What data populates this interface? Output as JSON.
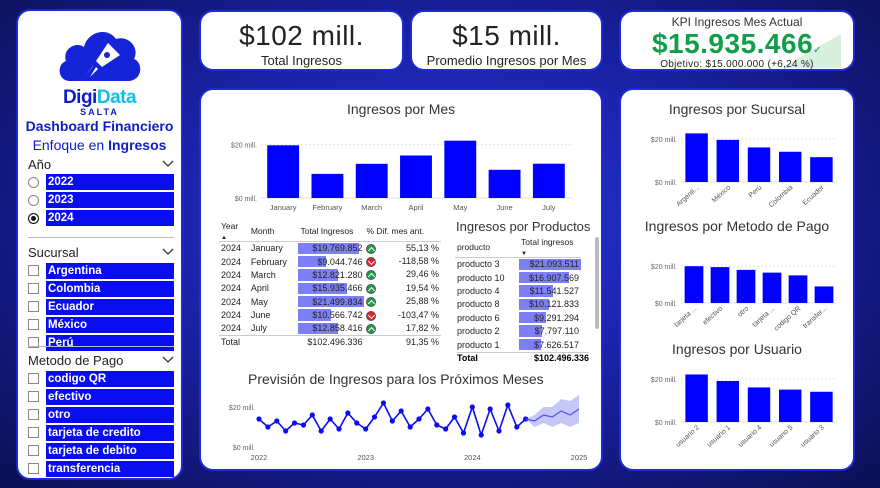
{
  "sidebar": {
    "logo": {
      "brand_a": "Digi",
      "brand_b": "Data",
      "sub": "SALTA"
    },
    "title_line1": "Dashboard Financiero",
    "title_line2_a": "Enfoque en ",
    "title_line2_b": "Ingresos",
    "year_filter": {
      "label": "Año",
      "options": [
        "2022",
        "2023",
        "2024"
      ],
      "selected": "2024"
    },
    "branch_filter": {
      "label": "Sucursal",
      "options": [
        "Argentina",
        "Colombia",
        "Ecuador",
        "México",
        "Perú"
      ]
    },
    "payment_filter": {
      "label": "Metodo de Pago",
      "options": [
        "codigo QR",
        "efectivo",
        "otro",
        "tarjeta de credito",
        "tarjeta de debito",
        "transferencia"
      ]
    }
  },
  "kpis": {
    "total": {
      "value": "$102 mill.",
      "label": "Total Ingresos"
    },
    "avg": {
      "value": "$15 mill.",
      "label": "Promedio Ingresos por Mes"
    },
    "current": {
      "title": "KPI Ingresos Mes Actual",
      "value": "$15.935.466",
      "goal": "Objetivo: $15.000.000 (+6,24 %)"
    }
  },
  "month_panel": {
    "title": "Ingresos por Mes",
    "table_headers": {
      "year": "Year",
      "month": "Month",
      "total": "Total Ingresos",
      "diff": "% Dif. mes ant."
    },
    "rows": [
      {
        "year": "2024",
        "month": "January",
        "total": "$19.769.852",
        "value": 19.77,
        "dir": "up",
        "diff": "55,13 %"
      },
      {
        "year": "2024",
        "month": "February",
        "total": "$9.044.746",
        "value": 9.04,
        "dir": "down",
        "diff": "-118,58 %"
      },
      {
        "year": "2024",
        "month": "March",
        "total": "$12.821.280",
        "value": 12.82,
        "dir": "up",
        "diff": "29,46 %"
      },
      {
        "year": "2024",
        "month": "April",
        "total": "$15.935.466",
        "value": 15.94,
        "dir": "up",
        "diff": "19,54 %"
      },
      {
        "year": "2024",
        "month": "May",
        "total": "$21.499.834",
        "value": 21.5,
        "dir": "up",
        "diff": "25,88 %"
      },
      {
        "year": "2024",
        "month": "June",
        "total": "$10.566.742",
        "value": 10.57,
        "dir": "down",
        "diff": "-103,47 %"
      },
      {
        "year": "2024",
        "month": "July",
        "total": "$12.858.416",
        "value": 12.86,
        "dir": "up",
        "diff": "17,82 %"
      }
    ],
    "total_row": {
      "label": "Total",
      "total": "$102.496.336",
      "diff": "91,35 %"
    }
  },
  "products_panel": {
    "title": "Ingresos por Productos",
    "headers": {
      "product": "producto",
      "total": "Total ingresos"
    },
    "rows": [
      {
        "name": "producto 3",
        "total": "$21.093.511",
        "value": 21.09
      },
      {
        "name": "producto 10",
        "total": "$16.907.569",
        "value": 16.91
      },
      {
        "name": "producto 4",
        "total": "$11.541.527",
        "value": 11.54
      },
      {
        "name": "producto 8",
        "total": "$10.121.833",
        "value": 10.12
      },
      {
        "name": "producto 6",
        "total": "$9.291.294",
        "value": 9.29
      },
      {
        "name": "producto 2",
        "total": "$7.797.110",
        "value": 7.8
      },
      {
        "name": "producto 1",
        "total": "$7.626.517",
        "value": 7.63
      }
    ],
    "total_row": {
      "label": "Total",
      "total": "$102.496.336"
    }
  },
  "forecast_title": "Previsión de Ingresos para los Próximos Meses",
  "right_titles": {
    "branch": "Ingresos por Sucursal",
    "payment": "Ingresos por Metodo de Pago",
    "user": "Ingresos por Usuario"
  },
  "colors": {
    "bar": "#0000ff",
    "accent": "#1c2bd8",
    "kpi_green": "#119e4a",
    "databar": "#7d7ff5"
  },
  "chart_data": [
    {
      "type": "bar",
      "title": "Ingresos por Mes",
      "categories": [
        "January",
        "February",
        "March",
        "April",
        "May",
        "June",
        "July"
      ],
      "values": [
        19.77,
        9.04,
        12.82,
        15.94,
        21.5,
        10.57,
        12.86
      ],
      "yticks": [
        "$20 mill.",
        "$0 mill."
      ],
      "ylim": [
        0,
        24
      ]
    },
    {
      "type": "bar",
      "title": "Ingresos por Sucursal",
      "categories": [
        "Argenti...",
        "México",
        "Perú",
        "Colombia",
        "Ecuador"
      ],
      "values": [
        22.5,
        19.5,
        16.0,
        14.0,
        11.5
      ],
      "yticks": [
        "$20 mill.",
        "$0 mill."
      ],
      "ylim": [
        0,
        25
      ]
    },
    {
      "type": "bar",
      "title": "Ingresos por Metodo de Pago",
      "categories": [
        "tarjeta ...",
        "efectivo",
        "otro",
        "tarjeta ...",
        "codigo QR",
        "transfer..."
      ],
      "values": [
        20.0,
        19.5,
        18.0,
        16.5,
        15.0,
        9.0
      ],
      "yticks": [
        "$20 mill.",
        "$0 mill."
      ],
      "ylim": [
        0,
        25
      ]
    },
    {
      "type": "bar",
      "title": "Ingresos por Usuario",
      "categories": [
        "usuario 2",
        "usuario 1",
        "usuario 4",
        "usuario 5",
        "usuario 3"
      ],
      "values": [
        22.0,
        19.0,
        16.0,
        15.0,
        14.0
      ],
      "yticks": [
        "$20 mill.",
        "$0 mill."
      ],
      "ylim": [
        0,
        25
      ]
    },
    {
      "type": "line",
      "title": "Previsión de Ingresos para los Próximos Meses",
      "xticks": [
        "2022",
        "2023",
        "2024",
        "2025"
      ],
      "x_range": [
        2022.0,
        2025.0
      ],
      "series": [
        {
          "x": [
            2022.0,
            2022.083,
            2022.167,
            2022.25,
            2022.333,
            2022.417,
            2022.5,
            2022.583,
            2022.667,
            2022.75,
            2022.833,
            2022.917,
            2023.0,
            2023.083,
            2023.167,
            2023.25,
            2023.333,
            2023.417,
            2023.5,
            2023.583,
            2023.667,
            2023.75,
            2023.833,
            2023.917,
            2024.0,
            2024.083,
            2024.167,
            2024.25,
            2024.333,
            2024.417,
            2024.5
          ],
          "values": [
            14,
            10,
            13,
            8,
            12,
            11,
            16,
            8,
            14,
            9,
            17,
            12,
            9,
            15,
            22,
            13,
            18,
            10,
            14,
            19,
            11,
            9,
            15,
            7,
            20,
            6,
            19,
            8,
            21,
            10,
            14
          ]
        },
        {
          "x": [
            2024.5,
            2024.583,
            2024.667,
            2024.75,
            2024.833,
            2024.917,
            2025.0
          ],
          "values": [
            14,
            13,
            16,
            15,
            18,
            16,
            19
          ],
          "band_low": [
            14,
            10,
            12,
            10,
            12,
            10,
            12
          ],
          "band_high": [
            14,
            16,
            20,
            20,
            24,
            23,
            26
          ]
        }
      ],
      "yticks": [
        "$20 mill.",
        "$0 mill."
      ],
      "ylim": [
        0,
        24
      ]
    }
  ]
}
